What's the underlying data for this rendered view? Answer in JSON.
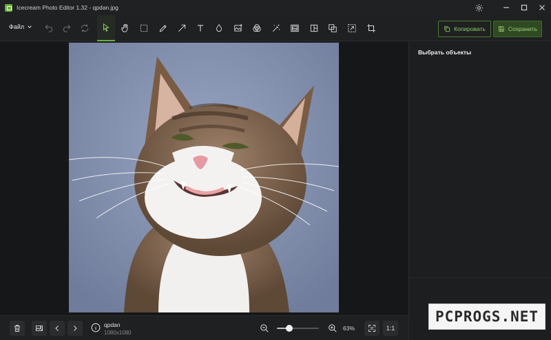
{
  "window": {
    "title": "Icecream Photo Editor 1.32 - qpdan.jpg"
  },
  "toolbar": {
    "file_menu_label": "Файл",
    "tools": [
      "undo-icon",
      "redo-icon",
      "reset-icon",
      "select-cursor-icon",
      "hand-icon",
      "marquee-select-icon",
      "brush-icon",
      "arrow-icon",
      "text-icon",
      "drop-icon",
      "image-icon",
      "fill-icon",
      "magic-wand-icon",
      "frame-icon",
      "collage-icon",
      "duplicate-icon",
      "resize-icon",
      "crop-icon"
    ],
    "active_tool": "select-cursor-icon",
    "copy_label": "Копировать",
    "save_label": "Сохранить",
    "accent_color": "#6bb23a"
  },
  "right_panel": {
    "title": "Выбрать объекты"
  },
  "bottom_bar": {
    "file_name": "qpdan",
    "file_dimensions": "1080x1080",
    "zoom_level": "63%",
    "zoom_fraction": 0.3,
    "actual_size_label": "1:1"
  },
  "watermark_text": "PCPROGS.NET"
}
